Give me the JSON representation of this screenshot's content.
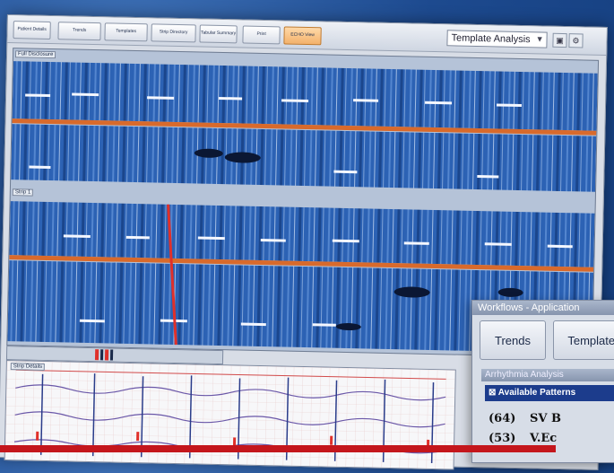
{
  "toolbar": {
    "buttons": [
      {
        "label": "Patient Details",
        "active": false
      },
      {
        "label": "Trends",
        "active": false
      },
      {
        "label": "Templates",
        "active": false
      },
      {
        "label": "Strip Directory",
        "active": false
      },
      {
        "label": "Tabular Summary",
        "active": false
      },
      {
        "label": "Print",
        "active": false
      },
      {
        "label": "ECHO View",
        "active": true
      }
    ],
    "template_select": "Template Analysis"
  },
  "strips": {
    "top_label": "Full Disclosure",
    "middle_label": "Strip 1"
  },
  "ecg_panel": {
    "label": "Strip Details"
  },
  "workflow": {
    "title": "Workflows - Application",
    "buttons": [
      "Trends",
      "Templates"
    ],
    "arrhythmia_title": "Arrhythmia Analysis",
    "patterns_header": "Available Patterns",
    "patterns": [
      {
        "count": "(64)",
        "name": "SV B"
      },
      {
        "count": "(53)",
        "name": "V.Ec"
      }
    ]
  },
  "colors": {
    "accent_active": "#f3b16b",
    "strip_blue": "#2c62b4",
    "divider_orange": "#d86a2c",
    "marker_red": "#e0302a",
    "brand_red": "#c4161c"
  }
}
